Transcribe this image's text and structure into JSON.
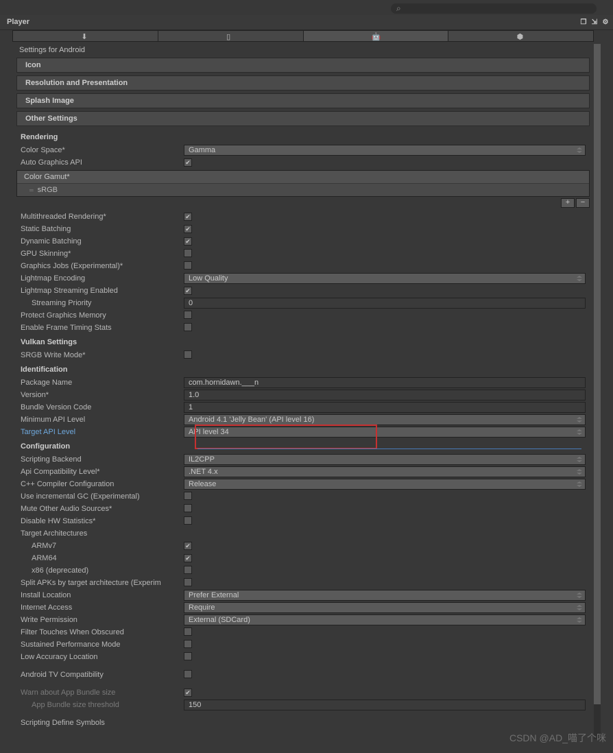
{
  "window": {
    "title": "Player",
    "watermark": "CSDN @AD_喵了个咪"
  },
  "settings_for": "Settings for Android",
  "sections": {
    "icon": "Icon",
    "resolution": "Resolution and Presentation",
    "splash": "Splash Image",
    "other": "Other Settings"
  },
  "rendering": {
    "heading": "Rendering",
    "color_space": {
      "label": "Color Space*",
      "value": "Gamma"
    },
    "auto_graphics_api": {
      "label": "Auto Graphics API",
      "checked": true
    },
    "color_gamut_label": "Color Gamut*",
    "color_gamut_item": "sRGB",
    "multithreaded": {
      "label": "Multithreaded Rendering*",
      "checked": true
    },
    "static_batching": {
      "label": "Static Batching",
      "checked": true
    },
    "dynamic_batching": {
      "label": "Dynamic Batching",
      "checked": true
    },
    "gpu_skinning": {
      "label": "GPU Skinning*",
      "checked": false
    },
    "graphics_jobs": {
      "label": "Graphics Jobs (Experimental)*",
      "checked": false
    },
    "lightmap_encoding": {
      "label": "Lightmap Encoding",
      "value": "Low Quality"
    },
    "lightmap_streaming": {
      "label": "Lightmap Streaming Enabled",
      "checked": true
    },
    "streaming_priority": {
      "label": "Streaming Priority",
      "value": "0"
    },
    "protect_graphics_memory": {
      "label": "Protect Graphics Memory",
      "checked": false
    },
    "enable_frame_timing": {
      "label": "Enable Frame Timing Stats",
      "checked": false
    }
  },
  "vulkan": {
    "heading": "Vulkan Settings",
    "srgb_write_mode": {
      "label": "SRGB Write Mode*",
      "checked": false
    }
  },
  "identification": {
    "heading": "Identification",
    "package_name": {
      "label": "Package Name",
      "value": "com.hornidawn.___n"
    },
    "version": {
      "label": "Version*",
      "value": "1.0"
    },
    "bundle_version_code": {
      "label": "Bundle Version Code",
      "value": "1"
    },
    "minimum_api": {
      "label": "Minimum API Level",
      "value": "Android 4.1 'Jelly Bean' (API level 16)"
    },
    "target_api": {
      "label": "Target API Level",
      "value": "API level 34"
    }
  },
  "configuration": {
    "heading": "Configuration",
    "scripting_backend": {
      "label": "Scripting Backend",
      "value": "IL2CPP"
    },
    "api_compat": {
      "label": "Api Compatibility Level*",
      "value": ".NET 4.x"
    },
    "cpp_compiler": {
      "label": "C++ Compiler Configuration",
      "value": "Release"
    },
    "incremental_gc": {
      "label": "Use incremental GC (Experimental)",
      "checked": false
    },
    "mute_audio": {
      "label": "Mute Other Audio Sources*",
      "checked": false
    },
    "disable_hw_stats": {
      "label": "Disable HW Statistics*",
      "checked": false
    },
    "target_arch": {
      "label": "Target Architectures"
    },
    "armv7": {
      "label": "ARMv7",
      "checked": true
    },
    "arm64": {
      "label": "ARM64",
      "checked": true
    },
    "x86": {
      "label": "x86 (deprecated)",
      "checked": false
    },
    "split_apks": {
      "label": "Split APKs by target architecture (Experim",
      "checked": false
    },
    "install_location": {
      "label": "Install Location",
      "value": "Prefer External"
    },
    "internet_access": {
      "label": "Internet Access",
      "value": "Require"
    },
    "write_permission": {
      "label": "Write Permission",
      "value": "External (SDCard)"
    },
    "filter_touches": {
      "label": "Filter Touches When Obscured",
      "checked": false
    },
    "sustained_perf": {
      "label": "Sustained Performance Mode",
      "checked": false
    },
    "low_accuracy": {
      "label": "Low Accuracy Location",
      "checked": false
    },
    "android_tv": {
      "label": "Android TV Compatibility",
      "checked": false
    },
    "warn_bundle": {
      "label": "Warn about App Bundle size",
      "checked": true
    },
    "bundle_threshold": {
      "label": "App Bundle size threshold",
      "value": "150"
    },
    "scripting_symbols": {
      "label": "Scripting Define Symbols"
    }
  },
  "highlight_box": {
    "note": "red rectangle around Minimum API Level and Target API Level dropdowns"
  }
}
